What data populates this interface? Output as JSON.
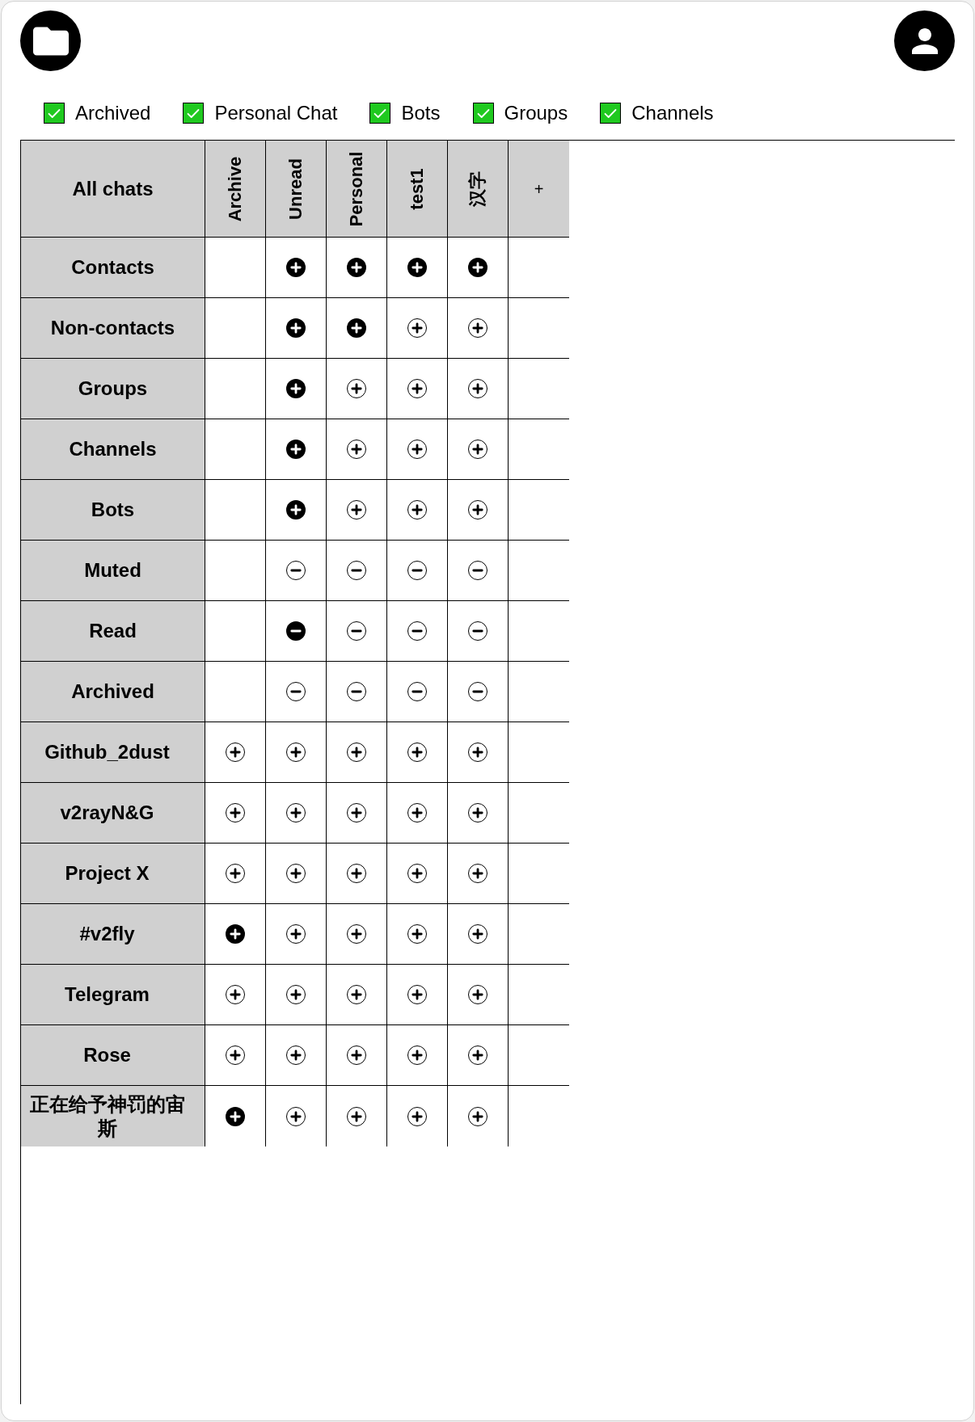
{
  "filters": [
    {
      "label": "Archived",
      "checked": true
    },
    {
      "label": "Personal Chat",
      "checked": true
    },
    {
      "label": "Bots",
      "checked": true
    },
    {
      "label": "Groups",
      "checked": true
    },
    {
      "label": "Channels",
      "checked": true
    }
  ],
  "table": {
    "corner": "All chats",
    "columns": [
      {
        "label": "Archive",
        "kind": "folder"
      },
      {
        "label": "Unread",
        "kind": "folder"
      },
      {
        "label": "Personal",
        "kind": "folder"
      },
      {
        "label": "test1",
        "kind": "folder"
      },
      {
        "label": "汉字",
        "kind": "folder"
      },
      {
        "label": "+",
        "kind": "add"
      }
    ],
    "rows": [
      {
        "label": "Contacts",
        "kind": "type",
        "cells": [
          {
            "kind": "empty"
          },
          {
            "kind": "include",
            "selected": true
          },
          {
            "kind": "include",
            "selected": true
          },
          {
            "kind": "include",
            "selected": true
          },
          {
            "kind": "include",
            "selected": true
          }
        ]
      },
      {
        "label": "Non-contacts",
        "kind": "type",
        "cells": [
          {
            "kind": "empty"
          },
          {
            "kind": "include",
            "selected": true
          },
          {
            "kind": "include",
            "selected": true
          },
          {
            "kind": "include",
            "selected": false
          },
          {
            "kind": "include",
            "selected": false
          }
        ]
      },
      {
        "label": "Groups",
        "kind": "type",
        "cells": [
          {
            "kind": "empty"
          },
          {
            "kind": "include",
            "selected": true
          },
          {
            "kind": "include",
            "selected": false
          },
          {
            "kind": "include",
            "selected": false
          },
          {
            "kind": "include",
            "selected": false
          }
        ]
      },
      {
        "label": "Channels",
        "kind": "type",
        "cells": [
          {
            "kind": "empty"
          },
          {
            "kind": "include",
            "selected": true
          },
          {
            "kind": "include",
            "selected": false
          },
          {
            "kind": "include",
            "selected": false
          },
          {
            "kind": "include",
            "selected": false
          }
        ]
      },
      {
        "label": "Bots",
        "kind": "type",
        "cells": [
          {
            "kind": "empty"
          },
          {
            "kind": "include",
            "selected": true
          },
          {
            "kind": "include",
            "selected": false
          },
          {
            "kind": "include",
            "selected": false
          },
          {
            "kind": "include",
            "selected": false
          }
        ]
      },
      {
        "label": "Muted",
        "kind": "type",
        "cells": [
          {
            "kind": "empty"
          },
          {
            "kind": "exclude",
            "selected": false
          },
          {
            "kind": "exclude",
            "selected": false
          },
          {
            "kind": "exclude",
            "selected": false
          },
          {
            "kind": "exclude",
            "selected": false
          }
        ]
      },
      {
        "label": "Read",
        "kind": "type",
        "cells": [
          {
            "kind": "empty"
          },
          {
            "kind": "exclude",
            "selected": true
          },
          {
            "kind": "exclude",
            "selected": false
          },
          {
            "kind": "exclude",
            "selected": false
          },
          {
            "kind": "exclude",
            "selected": false
          }
        ]
      },
      {
        "label": "Archived",
        "kind": "type",
        "cells": [
          {
            "kind": "empty"
          },
          {
            "kind": "exclude",
            "selected": false
          },
          {
            "kind": "exclude",
            "selected": false
          },
          {
            "kind": "exclude",
            "selected": false
          },
          {
            "kind": "exclude",
            "selected": false
          }
        ]
      },
      {
        "label": "Github_2dust",
        "kind": "chat",
        "cells": [
          {
            "kind": "include",
            "selected": false
          },
          {
            "kind": "include",
            "selected": false
          },
          {
            "kind": "include",
            "selected": false
          },
          {
            "kind": "include",
            "selected": false
          },
          {
            "kind": "include",
            "selected": false
          }
        ]
      },
      {
        "label": "v2rayN&G",
        "kind": "chat",
        "cells": [
          {
            "kind": "include",
            "selected": false
          },
          {
            "kind": "include",
            "selected": false
          },
          {
            "kind": "include",
            "selected": false
          },
          {
            "kind": "include",
            "selected": false
          },
          {
            "kind": "include",
            "selected": false
          }
        ]
      },
      {
        "label": "Project X",
        "kind": "chat",
        "cells": [
          {
            "kind": "include",
            "selected": false
          },
          {
            "kind": "include",
            "selected": false
          },
          {
            "kind": "include",
            "selected": false
          },
          {
            "kind": "include",
            "selected": false
          },
          {
            "kind": "include",
            "selected": false
          }
        ]
      },
      {
        "label": "#v2fly",
        "kind": "chat",
        "cells": [
          {
            "kind": "include",
            "selected": true
          },
          {
            "kind": "include",
            "selected": false
          },
          {
            "kind": "include",
            "selected": false
          },
          {
            "kind": "include",
            "selected": false
          },
          {
            "kind": "include",
            "selected": false
          }
        ]
      },
      {
        "label": "Telegram",
        "kind": "chat",
        "cells": [
          {
            "kind": "include",
            "selected": false
          },
          {
            "kind": "include",
            "selected": false
          },
          {
            "kind": "include",
            "selected": false
          },
          {
            "kind": "include",
            "selected": false
          },
          {
            "kind": "include",
            "selected": false
          }
        ]
      },
      {
        "label": "Rose",
        "kind": "chat",
        "cells": [
          {
            "kind": "include",
            "selected": false
          },
          {
            "kind": "include",
            "selected": false
          },
          {
            "kind": "include",
            "selected": false
          },
          {
            "kind": "include",
            "selected": false
          },
          {
            "kind": "include",
            "selected": false
          }
        ]
      },
      {
        "label": "正在给予神罚的宙斯",
        "kind": "chat",
        "cells": [
          {
            "kind": "include",
            "selected": true
          },
          {
            "kind": "include",
            "selected": false
          },
          {
            "kind": "include",
            "selected": false
          },
          {
            "kind": "include",
            "selected": false
          },
          {
            "kind": "include",
            "selected": false
          }
        ]
      }
    ]
  }
}
